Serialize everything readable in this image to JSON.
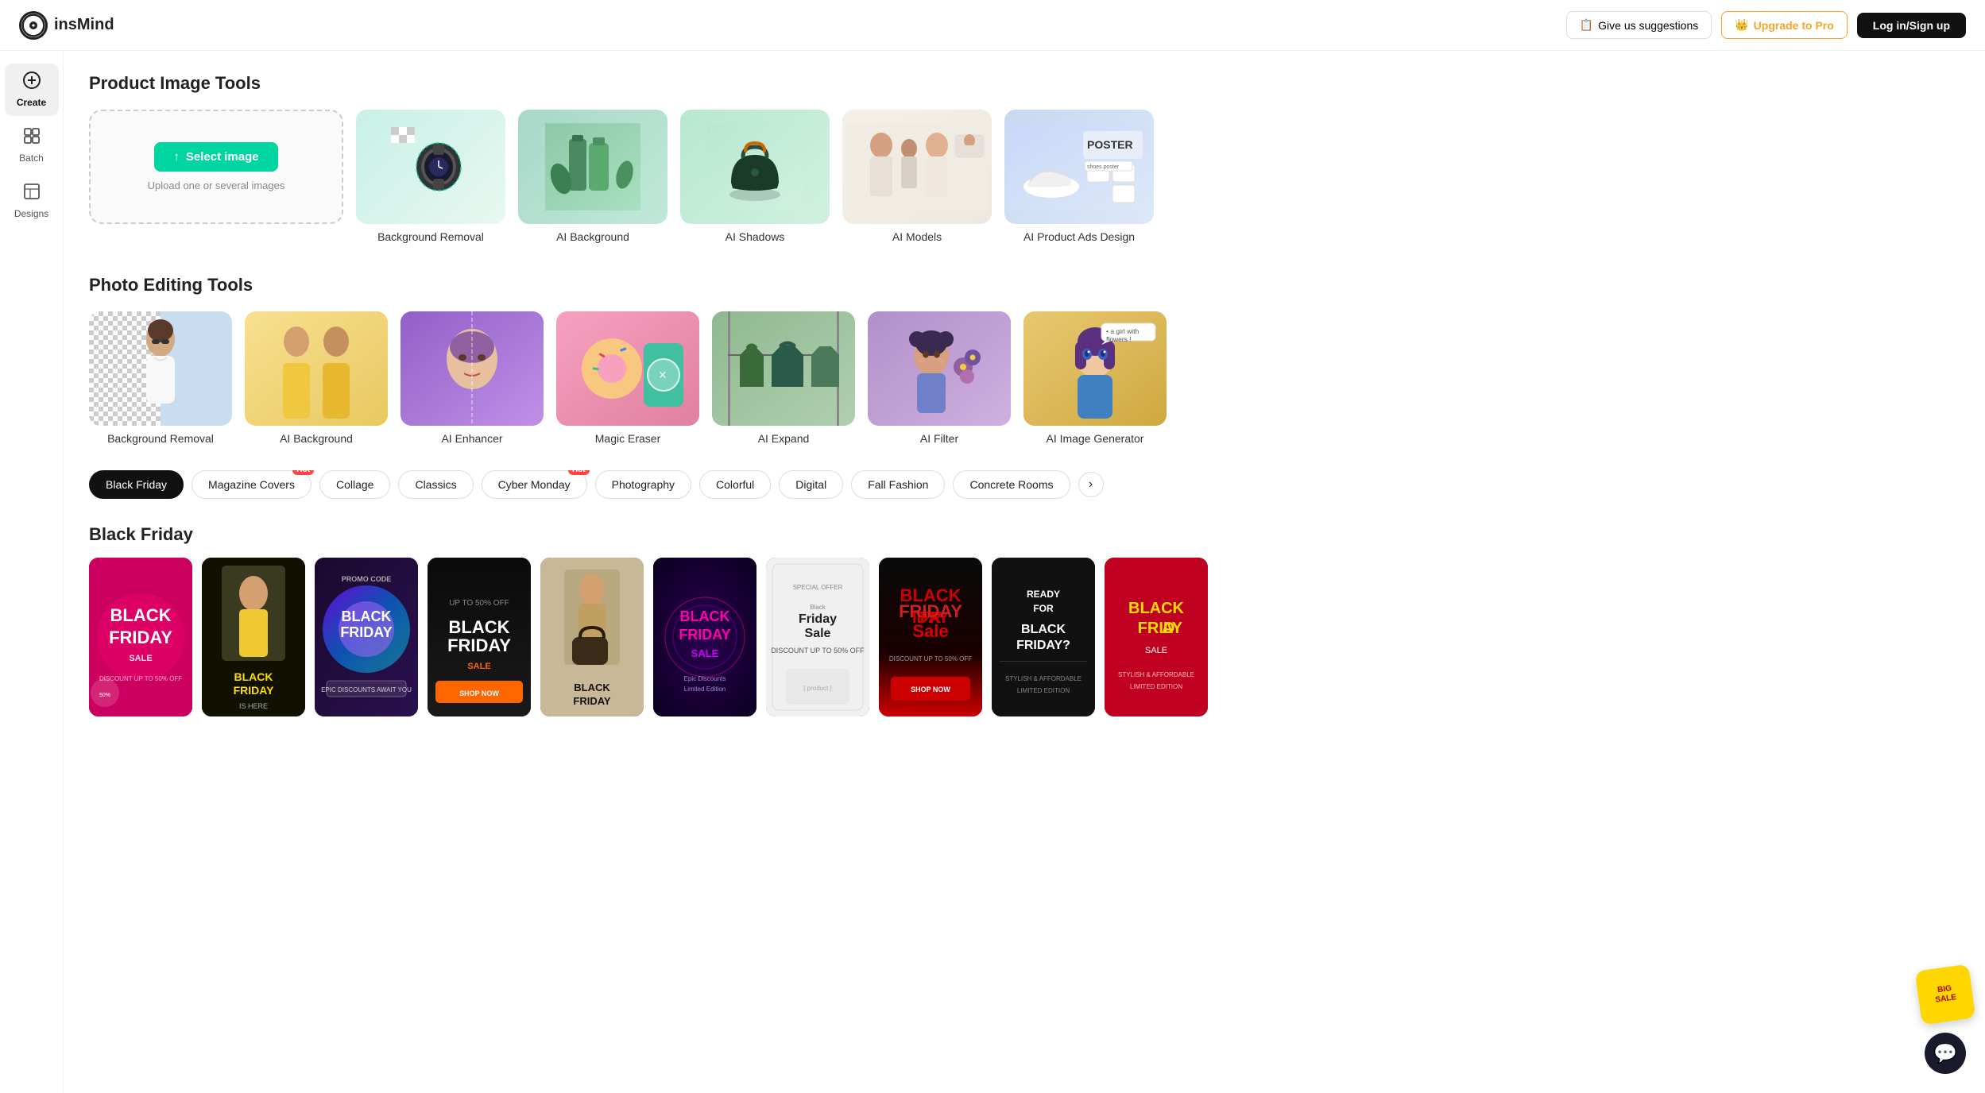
{
  "app": {
    "name": "insMind"
  },
  "header": {
    "logo_text": "insMind",
    "suggest_label": "Give us suggestions",
    "upgrade_label": "Upgrade to Pro",
    "login_label": "Log in/Sign up"
  },
  "sidebar": {
    "items": [
      {
        "id": "create",
        "label": "Create",
        "icon": "+"
      },
      {
        "id": "batch",
        "label": "Batch",
        "icon": "⊞"
      },
      {
        "id": "designs",
        "label": "Designs",
        "icon": "□"
      }
    ]
  },
  "product_tools": {
    "section_title": "Product Image Tools",
    "upload_card": {
      "button_label": "↑ Select image",
      "sub_label": "Upload one or several images"
    },
    "tools": [
      {
        "id": "bg-removal",
        "label": "Background Removal"
      },
      {
        "id": "ai-background",
        "label": "AI Background"
      },
      {
        "id": "ai-shadows",
        "label": "AI Shadows"
      },
      {
        "id": "ai-models",
        "label": "AI Models"
      },
      {
        "id": "ai-product-ads",
        "label": "AI Product Ads Design"
      }
    ]
  },
  "photo_tools": {
    "section_title": "Photo Editing Tools",
    "tools": [
      {
        "id": "pe-bg-removal",
        "label": "Background Removal"
      },
      {
        "id": "pe-ai-bg",
        "label": "AI Background"
      },
      {
        "id": "pe-enhancer",
        "label": "AI Enhancer"
      },
      {
        "id": "pe-magic-eraser",
        "label": "Magic Eraser"
      },
      {
        "id": "pe-ai-expand",
        "label": "AI Expand"
      },
      {
        "id": "pe-ai-filter",
        "label": "AI Filter"
      },
      {
        "id": "pe-image-gen",
        "label": "AI Image Generator"
      }
    ]
  },
  "filter_tabs": {
    "items": [
      {
        "id": "black-friday",
        "label": "Black Friday",
        "hot": false,
        "active": true
      },
      {
        "id": "magazine",
        "label": "Magazine Covers",
        "hot": true,
        "active": false
      },
      {
        "id": "collage",
        "label": "Collage",
        "hot": false,
        "active": false
      },
      {
        "id": "classics",
        "label": "Classics",
        "hot": false,
        "active": false
      },
      {
        "id": "cyber-monday",
        "label": "Cyber Monday",
        "hot": true,
        "active": false
      },
      {
        "id": "photography",
        "label": "Photography",
        "hot": false,
        "active": false
      },
      {
        "id": "colorful",
        "label": "Colorful",
        "hot": false,
        "active": false
      },
      {
        "id": "digital",
        "label": "Digital",
        "hot": false,
        "active": false
      },
      {
        "id": "fall-fashion",
        "label": "Fall Fashion",
        "hot": false,
        "active": false
      },
      {
        "id": "concrete-rooms",
        "label": "Concrete Rooms",
        "hot": false,
        "active": false
      }
    ]
  },
  "black_friday": {
    "section_title": "Black Friday",
    "templates": [
      {
        "id": "bf1",
        "bg": "#e8006e",
        "accent": "#ff6090"
      },
      {
        "id": "bf2",
        "bg": "#1a1a00",
        "accent": "#ffdd00"
      },
      {
        "id": "bf3",
        "bg": "#111111",
        "accent": "#00ccff"
      },
      {
        "id": "bf4",
        "bg": "#111111",
        "accent": "#ff6600"
      },
      {
        "id": "bf5",
        "bg": "#c8a878",
        "accent": "#000000"
      },
      {
        "id": "bf6",
        "bg": "#111111",
        "accent": "#ff00aa"
      },
      {
        "id": "bf7",
        "bg": "#f0f0f0",
        "accent": "#222222"
      },
      {
        "id": "bf8",
        "bg": "#cc0000",
        "accent": "#ffffff"
      },
      {
        "id": "bf9",
        "bg": "#111111",
        "accent": "#ffffff"
      },
      {
        "id": "bf10",
        "bg": "#d42020",
        "accent": "#ffdd00"
      }
    ]
  },
  "colors": {
    "accent_green": "#00d4a0",
    "accent_gold": "#f5a623",
    "promo_bg": "#ffd700",
    "dark": "#111111"
  }
}
